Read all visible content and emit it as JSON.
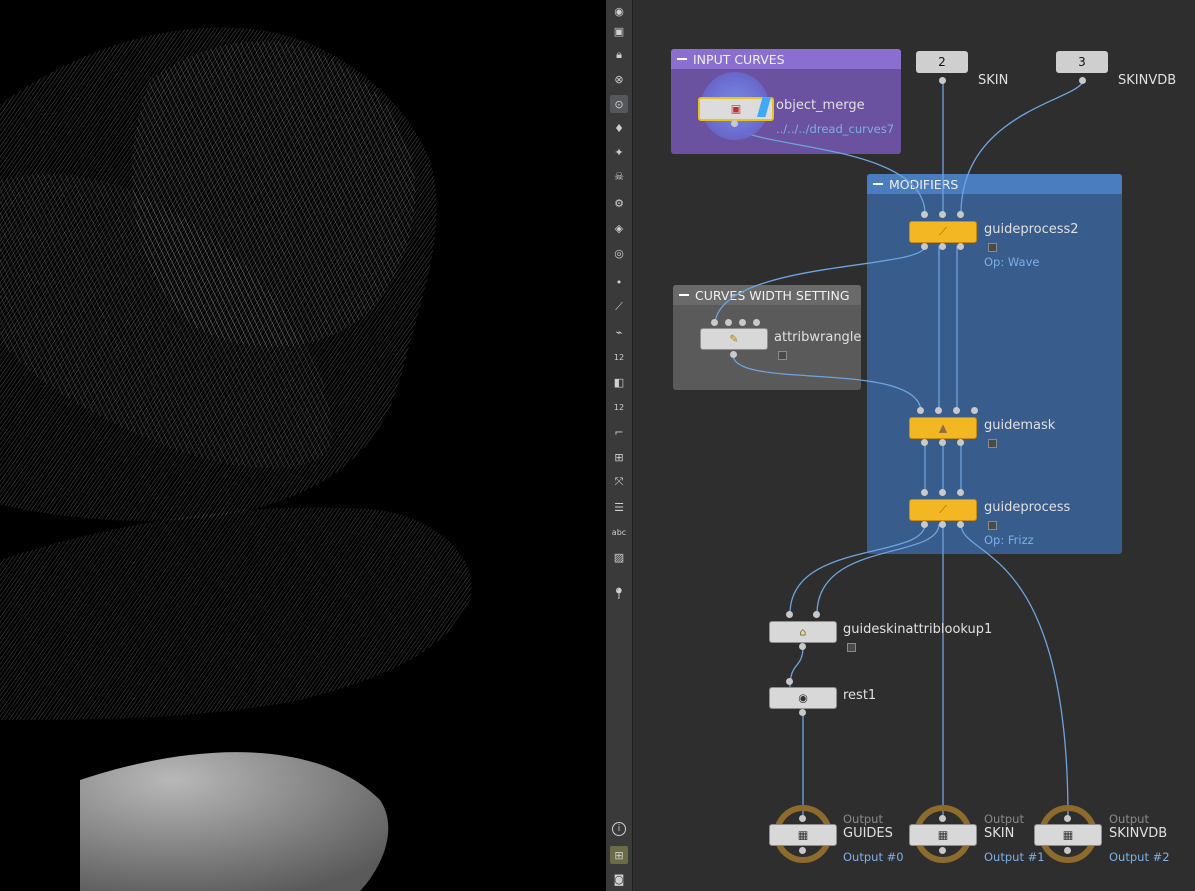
{
  "toolbar": {
    "icons": [
      "eye-icon",
      "display-icon",
      "lock-icon",
      "ghost-icon",
      "zoom-icon",
      "light-icon",
      "light-icon",
      "skull-icon",
      "paint-icon",
      "camera-icon",
      "snap-icon",
      "point-icon",
      "brush-icon",
      "dropper-icon",
      "select-count-icon",
      "select-count-icon",
      "curve-icon",
      "transform-icon",
      "node-edit-icon",
      "list-icon",
      "text-icon",
      "image-icon",
      "pin-icon",
      "info-icon",
      "grid-icon",
      "view-icon"
    ],
    "labels": {
      "count_a": "12",
      "count_b": "12",
      "text_tool": "abc",
      "info": "i"
    }
  },
  "network": {
    "boxes": {
      "input_curves": {
        "title": "INPUT CURVES",
        "color": "#7f5fc7"
      },
      "modifiers": {
        "title": "MODIFIERS",
        "color": "#3d6fb0"
      },
      "curves_width": {
        "title": "CURVES WIDTH SETTING",
        "color": "#5f5f5f"
      }
    },
    "inputs": [
      {
        "number": "2",
        "label": "SKIN"
      },
      {
        "number": "3",
        "label": "SKINVDB"
      }
    ],
    "nodes": {
      "object_merge": {
        "name": "object_merge",
        "sub": "../../../dread_curves7"
      },
      "guideprocess2": {
        "name": "guideprocess2",
        "sub": "Op: Wave"
      },
      "attribwrangle": {
        "name": "attribwrangle"
      },
      "guidemask": {
        "name": "guidemask"
      },
      "guideprocess": {
        "name": "guideprocess",
        "sub": "Op: Frizz"
      },
      "guideskinattriblookup1": {
        "name": "guideskinattriblookup1"
      },
      "rest1": {
        "name": "rest1"
      }
    },
    "outputs": [
      {
        "kind": "Output",
        "name": "GUIDES",
        "sub": "Output #0"
      },
      {
        "kind": "Output",
        "name": "SKIN",
        "sub": "Output #1"
      },
      {
        "kind": "Output",
        "name": "SKINVDB",
        "sub": "Output #2"
      }
    ]
  },
  "colors": {
    "wire": "#6fa3dd",
    "yellow_node": "#f3b724",
    "ring": "#8c6b2c",
    "accent_text": "#7eaee6"
  }
}
